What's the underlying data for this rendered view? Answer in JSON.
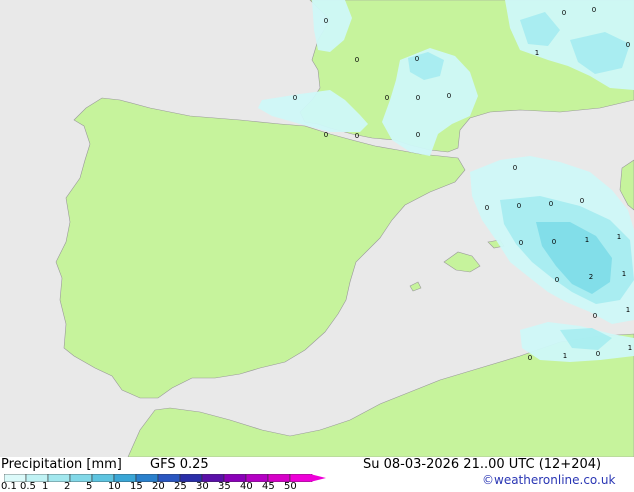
{
  "colors": {
    "sea": "#e9e9e9",
    "land": "#c6f39c",
    "border": "#8a8a8a",
    "precip_light": "#cff8f8",
    "precip_mid": "#a6ecf0",
    "precip_heavy": "#7ddbe8"
  },
  "map": {
    "region": "Iberian Peninsula, southern France, western Mediterranean, North Africa",
    "grid_values": [
      {
        "label": "0"
      },
      {
        "label": "0"
      },
      {
        "label": "0"
      },
      {
        "label": "1"
      },
      {
        "label": "0"
      },
      {
        "label": "0"
      },
      {
        "label": "0"
      },
      {
        "label": "0"
      },
      {
        "label": "0"
      },
      {
        "label": "0"
      },
      {
        "label": "0"
      },
      {
        "label": "0"
      },
      {
        "label": "0"
      },
      {
        "label": "0"
      },
      {
        "label": "0"
      },
      {
        "label": "0"
      },
      {
        "label": "0"
      },
      {
        "label": "0"
      },
      {
        "label": "0"
      },
      {
        "label": "1"
      },
      {
        "label": "1"
      },
      {
        "label": "0"
      },
      {
        "label": "1"
      },
      {
        "label": "0"
      },
      {
        "label": "2"
      },
      {
        "label": "1"
      },
      {
        "label": "0"
      },
      {
        "label": "0"
      },
      {
        "label": "1"
      },
      {
        "label": "0"
      },
      {
        "label": "1"
      },
      {
        "label": "0"
      }
    ]
  },
  "footer": {
    "title": "Precipitation [mm]",
    "model": "GFS 0.25",
    "datetime": "Su 08-03-2026 21..00 UTC (12+204)",
    "credit": "©weatheronline.co.uk",
    "legend": {
      "ticks": [
        "0.1",
        "0.5",
        "1",
        "2",
        "5",
        "10",
        "15",
        "20",
        "25",
        "30",
        "35",
        "40",
        "45",
        "50"
      ],
      "colors": [
        "#dcfafa",
        "#c0f2f4",
        "#a2e7ee",
        "#82d8e8",
        "#5ec4e0",
        "#3aa6d6",
        "#2a80cc",
        "#2a56c0",
        "#2a2ea8",
        "#5a10a8",
        "#8a00b8",
        "#b400c4",
        "#d600c8",
        "#ee00d8"
      ]
    }
  }
}
